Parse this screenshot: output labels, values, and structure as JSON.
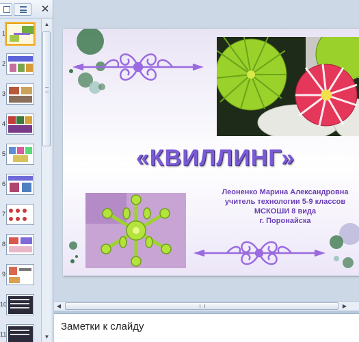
{
  "thumbnail_pane": {
    "tabs": {
      "slides_icon": "slides-tab-icon",
      "outline_icon": "outline-tab-icon"
    },
    "close_glyph": "✕",
    "slide_numbers": [
      "1",
      "2",
      "3",
      "4",
      "5",
      "6",
      "7",
      "8",
      "9",
      "10",
      "11"
    ],
    "selected_slide": "1"
  },
  "slide": {
    "title": "«КВИЛЛИНГ»",
    "author_lines": [
      "Леоненко Марина Александровна",
      "учитель технологии 5-9 классов",
      "МСКОШИ  8 вида",
      "г. Поронайска"
    ],
    "colors": {
      "title": "#7b5bd4",
      "author": "#6a3fb5",
      "ornament": "#9a6be0",
      "circles": "#4f8a5f"
    }
  },
  "notes": {
    "placeholder": "Заметки к слайду"
  }
}
